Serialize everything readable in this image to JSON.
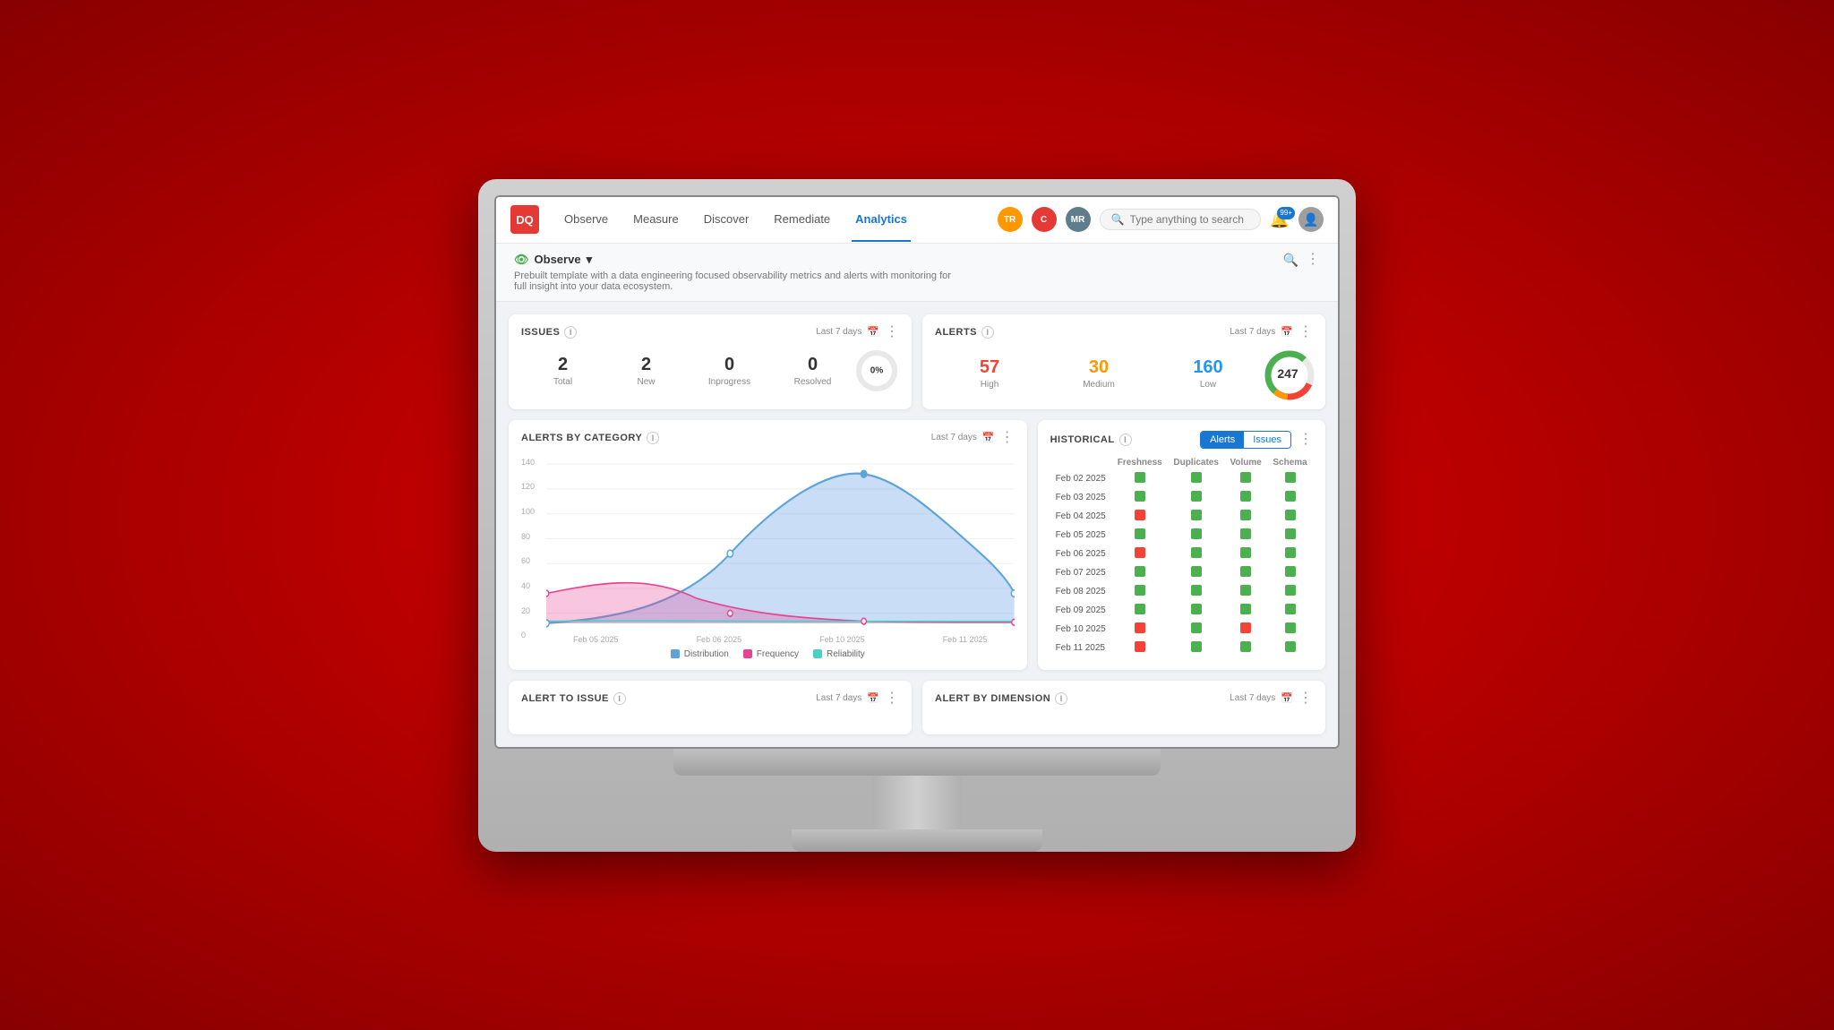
{
  "app": {
    "logo": "DQ",
    "nav": {
      "links": [
        {
          "label": "Observe",
          "active": false
        },
        {
          "label": "Measure",
          "active": false
        },
        {
          "label": "Discover",
          "active": false
        },
        {
          "label": "Remediate",
          "active": false
        },
        {
          "label": "Analytics",
          "active": true
        }
      ]
    },
    "search": {
      "placeholder": "Type anything to search"
    },
    "avatars": [
      {
        "initials": "TR",
        "color": "#ff9800"
      },
      {
        "initials": "C",
        "color": "#e53935"
      },
      {
        "initials": "MR",
        "color": "#607d8b"
      }
    ],
    "notification_badge": "99+"
  },
  "subheader": {
    "label": "Observe",
    "dropdown_arrow": "▾",
    "description": "Prebuilt template with a data engineering focused observability metrics and alerts with monitoring for full insight into your data ecosystem."
  },
  "issues": {
    "title": "ISSUES",
    "date_range": "Last 7 days",
    "stats": [
      {
        "value": "2",
        "label": "Total"
      },
      {
        "value": "2",
        "label": "New"
      },
      {
        "value": "0",
        "label": "Inprogress"
      },
      {
        "value": "0",
        "label": "Resolved"
      }
    ],
    "donut_percent": "0%"
  },
  "alerts": {
    "title": "ALERTS",
    "date_range": "Last 7 days",
    "stats": [
      {
        "value": "57",
        "label": "High"
      },
      {
        "value": "30",
        "label": "Medium"
      },
      {
        "value": "160",
        "label": "Low"
      }
    ],
    "donut_value": "247"
  },
  "alerts_by_category": {
    "title": "ALERTS BY CATEGORY",
    "date_range": "Last 7 days",
    "y_labels": [
      "140",
      "120",
      "100",
      "80",
      "60",
      "40",
      "20",
      "0"
    ],
    "x_labels": [
      "Feb 05 2025",
      "Feb 06 2025",
      "Feb 10 2025",
      "Feb 11 2025"
    ],
    "legend": [
      {
        "label": "Distribution",
        "color": "#7eb3e8"
      },
      {
        "label": "Frequency",
        "color": "#e84393"
      },
      {
        "label": "Reliability",
        "color": "#4dd0c4"
      }
    ]
  },
  "historical": {
    "title": "HISTORICAL",
    "tabs": [
      "Alerts",
      "Issues"
    ],
    "active_tab": "Alerts",
    "columns": [
      "",
      "Freshness",
      "Duplicates",
      "Volume",
      "Schema"
    ],
    "rows": [
      {
        "date": "Feb 02 2025",
        "freshness": "green",
        "duplicates": "green",
        "volume": "green",
        "schema": "green"
      },
      {
        "date": "Feb 03 2025",
        "freshness": "green",
        "duplicates": "green",
        "volume": "green",
        "schema": "green"
      },
      {
        "date": "Feb 04 2025",
        "freshness": "red",
        "duplicates": "green",
        "volume": "green",
        "schema": "green"
      },
      {
        "date": "Feb 05 2025",
        "freshness": "green",
        "duplicates": "green",
        "volume": "green",
        "schema": "green"
      },
      {
        "date": "Feb 06 2025",
        "freshness": "red",
        "duplicates": "green",
        "volume": "green",
        "schema": "green"
      },
      {
        "date": "Feb 07 2025",
        "freshness": "green",
        "duplicates": "green",
        "volume": "green",
        "schema": "green"
      },
      {
        "date": "Feb 08 2025",
        "freshness": "green",
        "duplicates": "green",
        "volume": "green",
        "schema": "green"
      },
      {
        "date": "Feb 09 2025",
        "freshness": "green",
        "duplicates": "green",
        "volume": "green",
        "schema": "green"
      },
      {
        "date": "Feb 10 2025",
        "freshness": "red",
        "duplicates": "green",
        "volume": "red",
        "schema": "green"
      },
      {
        "date": "Feb 11 2025",
        "freshness": "red",
        "duplicates": "green",
        "volume": "green",
        "schema": "green"
      }
    ]
  },
  "alert_to_issue": {
    "title": "ALERT TO ISSUE",
    "date_range": "Last 7 days"
  },
  "alert_by_dimension": {
    "title": "ALERT BY DIMENSION",
    "date_range": "Last 7 days"
  }
}
